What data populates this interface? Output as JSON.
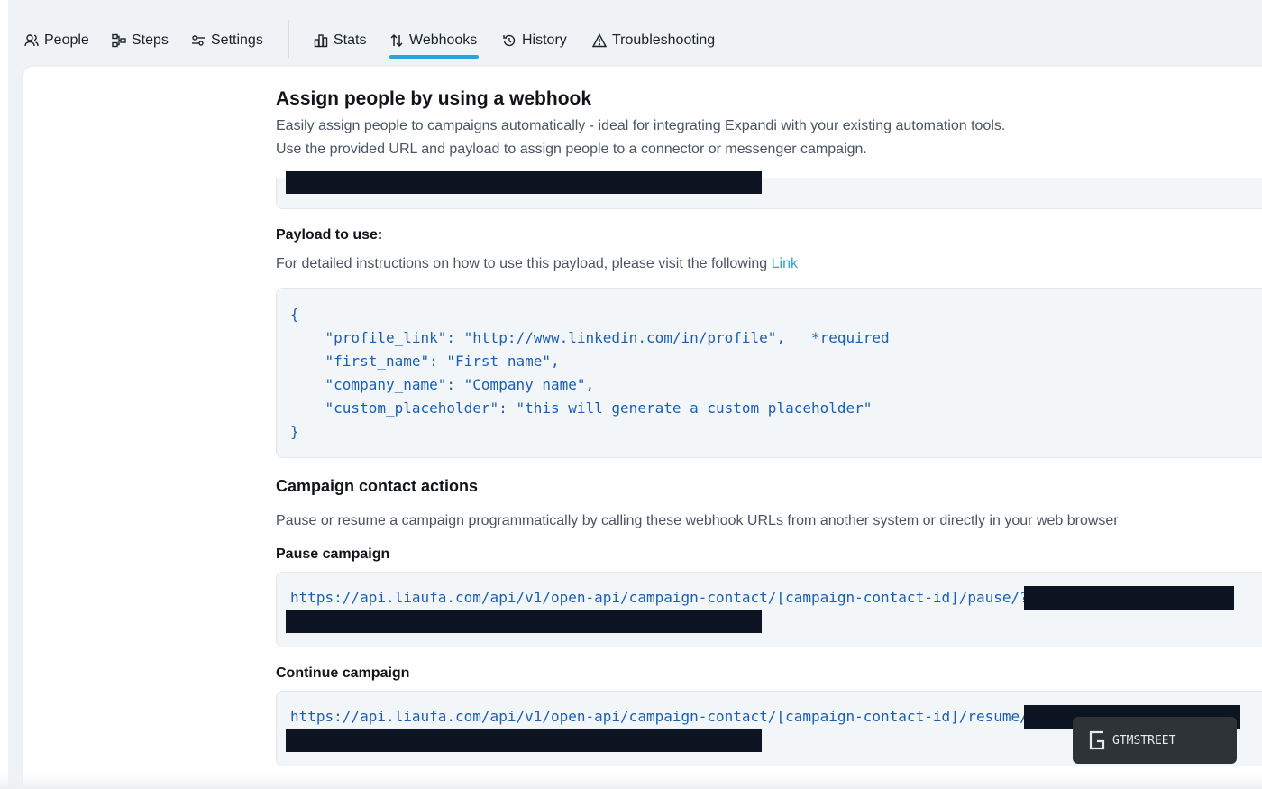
{
  "tabs": [
    {
      "label": "People",
      "icon": "people-icon",
      "active": false
    },
    {
      "label": "Steps",
      "icon": "steps-icon",
      "active": false
    },
    {
      "label": "Settings",
      "icon": "settings-icon",
      "active": false
    },
    {
      "label": "Stats",
      "icon": "stats-icon",
      "active": false
    },
    {
      "label": "Webhooks",
      "icon": "webhooks-icon",
      "active": true
    },
    {
      "label": "History",
      "icon": "history-icon",
      "active": false
    },
    {
      "label": "Troubleshooting",
      "icon": "warning-icon",
      "active": false
    }
  ],
  "webhook": {
    "title": "Assign people by using a webhook",
    "desc1": "Easily assign people to campaigns automatically - ideal for integrating Expandi with your existing automation tools.",
    "desc2": "Use the provided URL and payload to assign people to a connector or messenger campaign.",
    "payload_label": "Payload to use:",
    "payload_desc": "For detailed instructions on how to use this payload, please visit the following",
    "payload_link": "Link",
    "payload_code": "{\n    \"profile_link\": \"http://www.linkedin.com/in/profile\",   *required\n    \"first_name\": \"First name\",\n    \"company_name\": \"Company name\",\n    \"custom_placeholder\": \"this will generate a custom placeholder\"\n}"
  },
  "actions": {
    "title": "Campaign contact actions",
    "desc": "Pause or resume a campaign programmatically by calling these webhook URLs from another system or directly in your web browser",
    "pause_label": "Pause campaign",
    "pause_url": "https://api.liaufa.com/api/v1/open-api/campaign-contact/[campaign-contact-id]/pause/?key=",
    "continue_label": "Continue campaign",
    "continue_url": "https://api.liaufa.com/api/v1/open-api/campaign-contact/[campaign-contact-id]/resume/?key="
  },
  "watermark": {
    "text": "GTMSTREET"
  },
  "colors": {
    "accent": "#2aa4d9",
    "code": "#1a5fb4",
    "redaction": "#0b1420"
  }
}
